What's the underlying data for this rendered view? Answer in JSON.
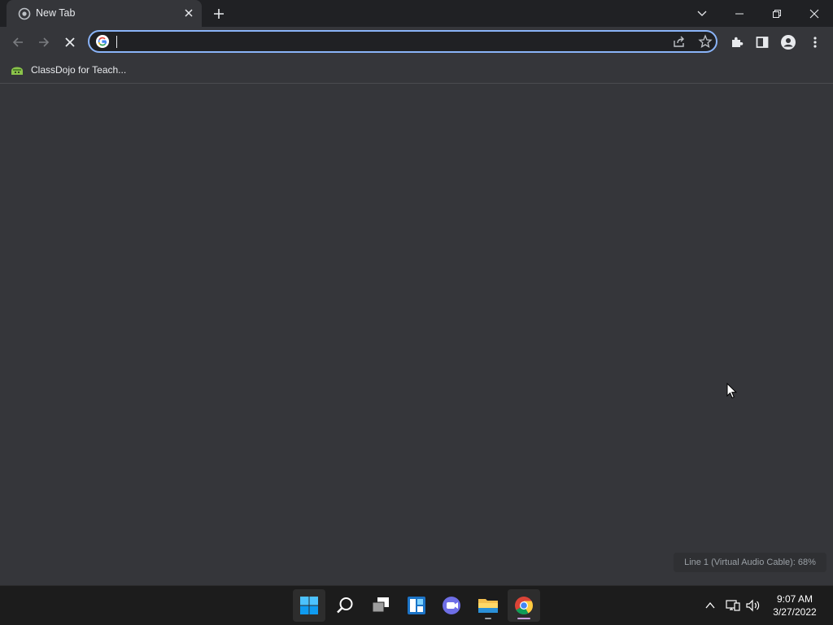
{
  "browser": {
    "tab_title": "New Tab",
    "omnibox_value": "",
    "bookmark_label": "ClassDojo for Teach..."
  },
  "osd": {
    "text": "Line 1 (Virtual Audio Cable): 68%"
  },
  "taskbar": {
    "time": "9:07 AM",
    "date": "3/27/2022",
    "apps": [
      "start-icon",
      "search-icon",
      "task-view-icon",
      "widgets-icon",
      "teams-chat-icon",
      "file-explorer-icon",
      "chrome-icon"
    ]
  },
  "colors": {
    "window_bg": "#35363a",
    "frame_bg": "#202124",
    "omnibox_focus": "#8ab4f8",
    "taskbar_bg": "#1c1c1c"
  }
}
